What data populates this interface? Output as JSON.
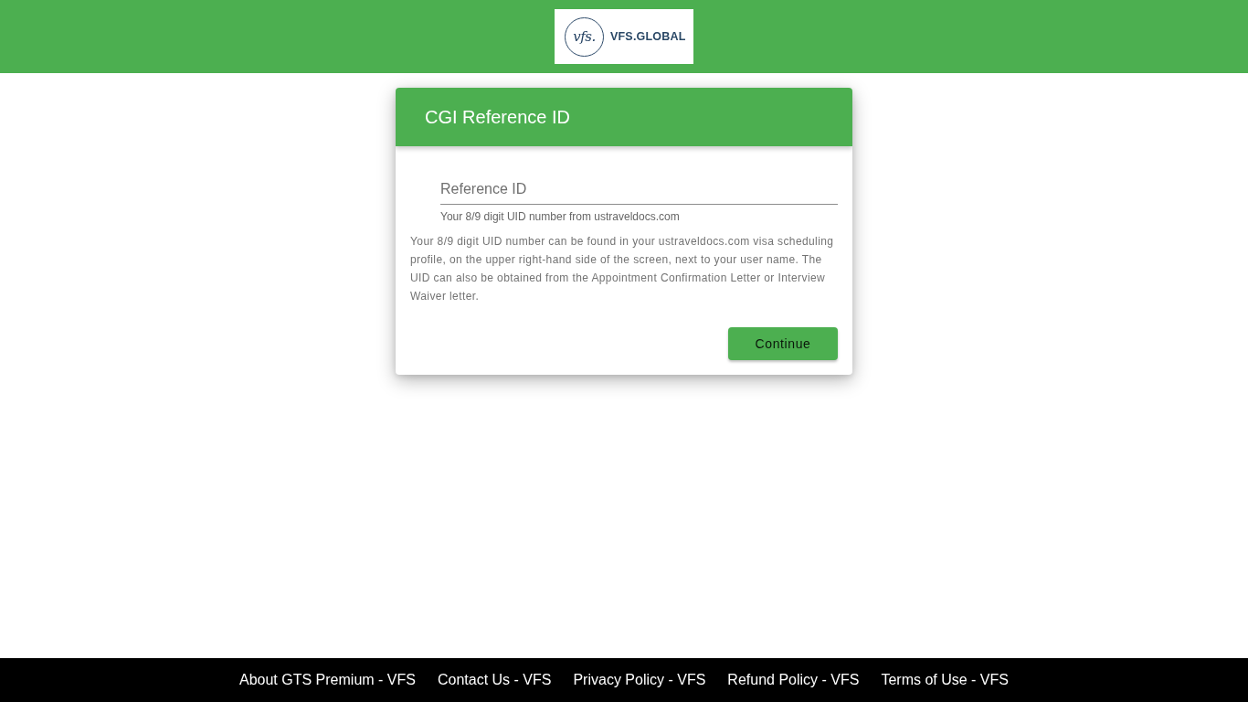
{
  "header": {
    "logo": {
      "emblem": "vfs.",
      "wordmark": "VFS.GLOBAL"
    }
  },
  "card": {
    "title": "CGI Reference ID",
    "field": {
      "placeholder": "Reference ID",
      "hint": "Your 8/9 digit UID number from ustraveldocs.com"
    },
    "description": "Your 8/9 digit UID number can be found in your ustraveldocs.com visa scheduling profile, on the upper right-hand side of the screen, next to your user name. The UID can also be obtained from the Appointment Confirmation Letter or Interview Waiver letter.",
    "button": "Continue"
  },
  "footer": {
    "links": [
      "About GTS Premium - VFS",
      "Contact Us - VFS",
      "Privacy Policy - VFS",
      "Refund Policy - VFS",
      "Terms of Use - VFS"
    ]
  }
}
